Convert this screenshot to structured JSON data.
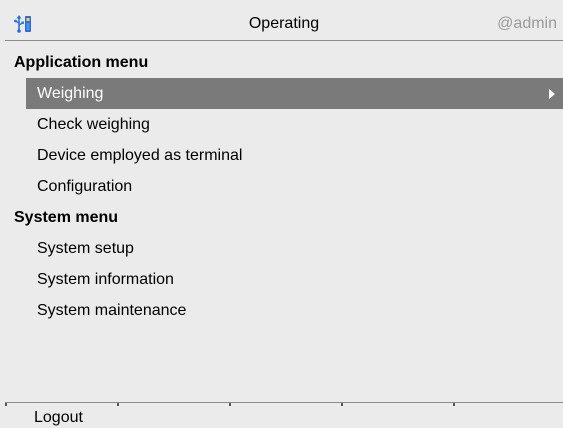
{
  "header": {
    "title": "Operating",
    "user": "@admin",
    "icon": "usb-connection-icon"
  },
  "menu": {
    "sections": [
      {
        "title": "Application menu",
        "items": [
          {
            "label": "Weighing",
            "selected": true
          },
          {
            "label": "Check weighing"
          },
          {
            "label": "Device employed as terminal"
          },
          {
            "label": "Configuration"
          }
        ]
      },
      {
        "title": "System menu",
        "items": [
          {
            "label": "System setup"
          },
          {
            "label": "System information"
          },
          {
            "label": "System maintenance"
          }
        ]
      }
    ]
  },
  "softkeys": [
    "Logout",
    "",
    "",
    "",
    ""
  ],
  "colors": {
    "background": "#ebebeb",
    "selected_bg": "#7a7a7a",
    "selected_text": "#ffffff",
    "user_text": "#9a9a9a",
    "icon_accent": "#2a6fd6"
  }
}
